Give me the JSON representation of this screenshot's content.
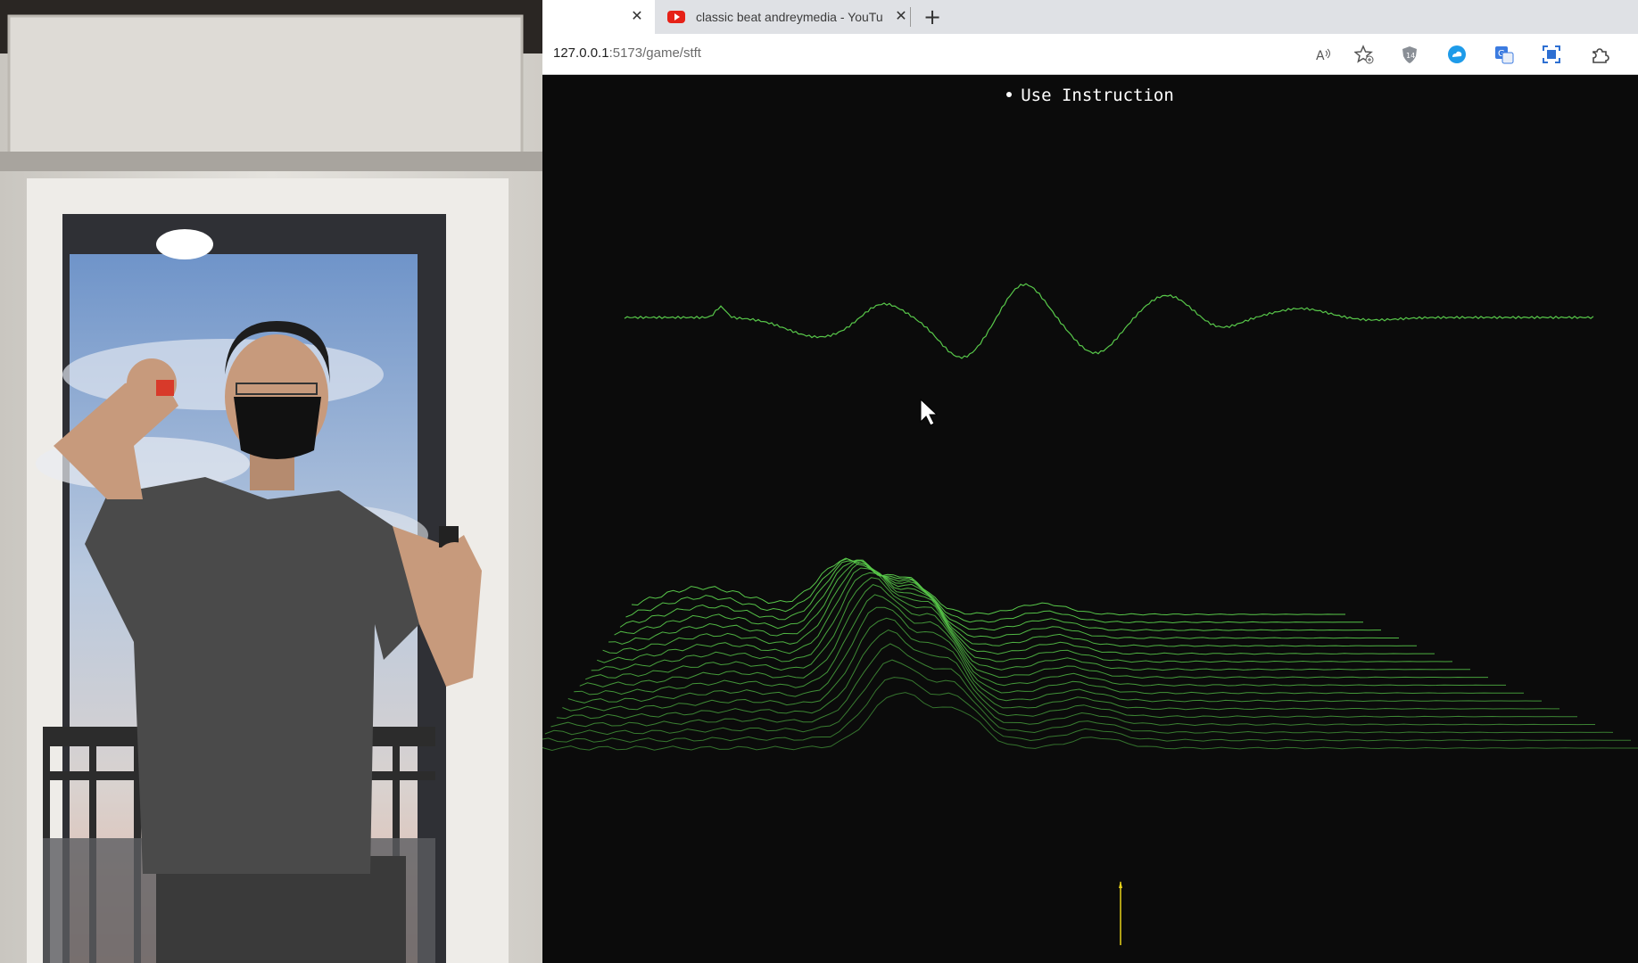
{
  "browser": {
    "tabs": [
      {
        "label": "",
        "favicon": "none",
        "active": true
      },
      {
        "label": "classic beat andreymedia - YouTu",
        "favicon": "youtube-icon",
        "active": false
      }
    ],
    "new_tab_symbol": "+",
    "close_symbol": "✕",
    "url": {
      "host": "127.0.0.1",
      "rest": ":5173/game/stft"
    },
    "toolbar_icons": [
      "read-aloud-icon",
      "favorite-add-icon",
      "shield-extension-icon",
      "cloud-extension-icon",
      "translate-extension-icon",
      "screenshot-icon",
      "extensions-icon"
    ]
  },
  "page": {
    "instruction": "Use Instruction",
    "colors": {
      "background": "#0b0b0b",
      "wave": "#58c84a",
      "marker": "#e8d21a",
      "text": "#ffffff"
    }
  },
  "camera": {
    "content": "person holding motion controllers in front of a window"
  }
}
